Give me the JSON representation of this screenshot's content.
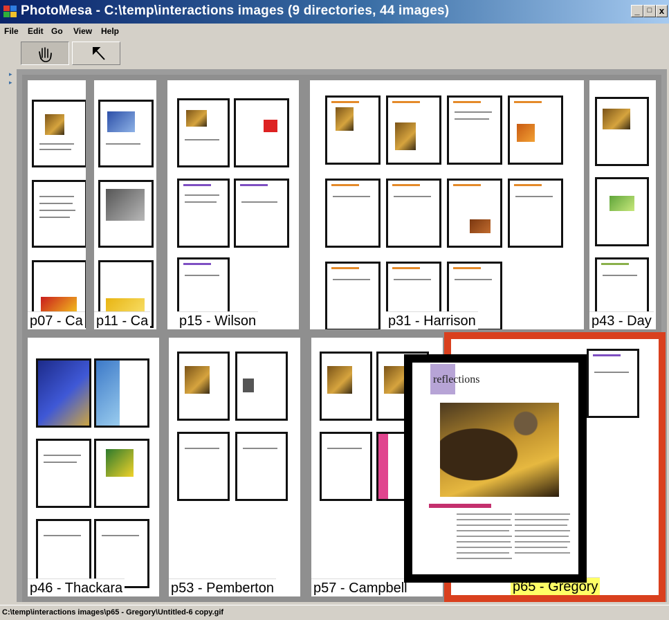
{
  "window": {
    "title": "PhotoMesa - C:\\temp\\interactions images (9 directories, 44 images)",
    "controls": {
      "minimize": "_",
      "maximize": "□",
      "close": "x"
    }
  },
  "menu": [
    "File",
    "Edit",
    "Go",
    "View",
    "Help"
  ],
  "toolbar": {
    "tools": [
      {
        "name": "pan",
        "icon": "hand-icon",
        "glyph": "☚",
        "active": true
      },
      {
        "name": "select",
        "icon": "arrow-pointer-icon",
        "glyph": "↖",
        "active": false
      }
    ]
  },
  "groups": [
    {
      "label": "p07 - Ca",
      "selected": false
    },
    {
      "label": "p11 - Ca",
      "selected": false
    },
    {
      "label": "p15 - Wilson",
      "selected": false
    },
    {
      "label": "p31 - Harrison",
      "selected": false
    },
    {
      "label": "p43 - Day",
      "selected": false
    },
    {
      "label": "p46 - Thackara",
      "selected": false
    },
    {
      "label": "p53 - Pemberton",
      "selected": false
    },
    {
      "label": "p57 - Campbell",
      "selected": false
    },
    {
      "label": "p65 - Gregory",
      "selected": true
    }
  ],
  "focus": {
    "title": "reflections"
  },
  "status": {
    "path": "C:\\temp\\interactions images\\p65 - Gregory\\Untitled-6 copy.gif"
  },
  "colors": {
    "selected_border": "#d9401e",
    "selected_label": "#ffff66",
    "title_bar": "#0a246a"
  }
}
